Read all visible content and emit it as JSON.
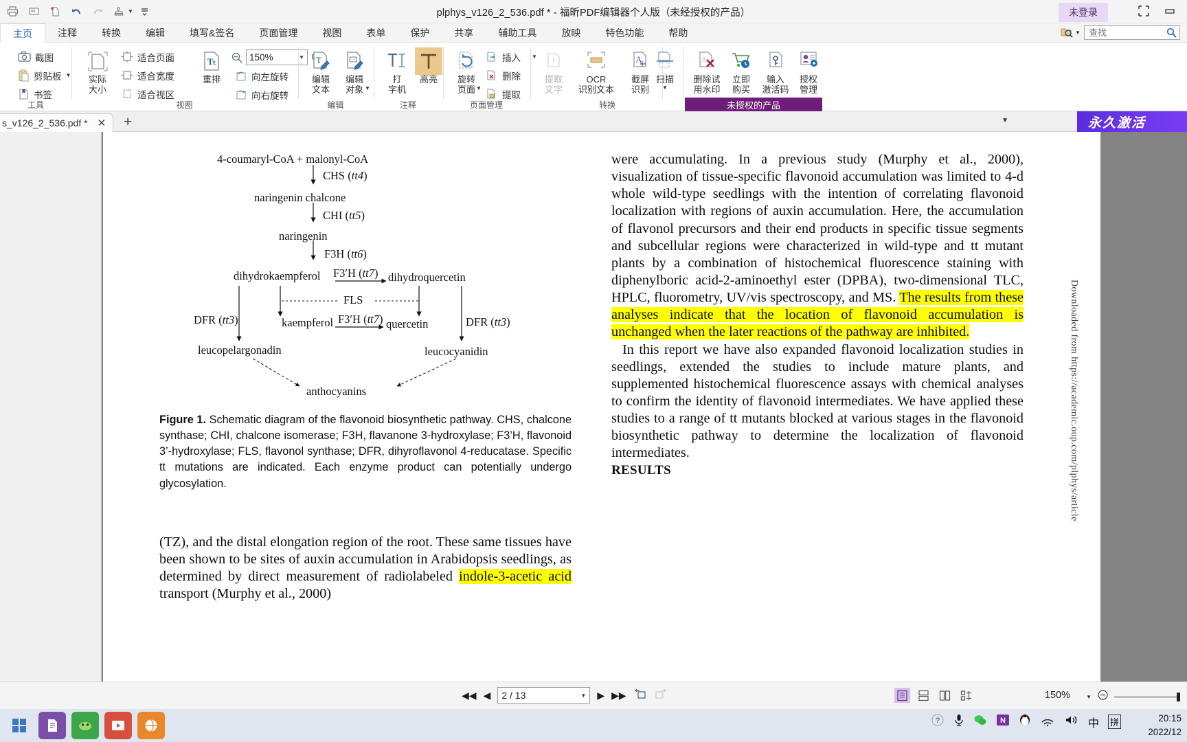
{
  "titlebar": {
    "title": "plphys_v126_2_536.pdf * - 福昕PDF编辑器个人版（未经授权的产品）",
    "login_badge": "未登录",
    "quick_access": [
      {
        "name": "print-icon",
        "label": "打印"
      },
      {
        "name": "email-icon",
        "label": "邮件"
      },
      {
        "name": "new-document-icon",
        "label": "新建"
      },
      {
        "name": "undo-icon",
        "label": "撤销"
      },
      {
        "name": "redo-icon",
        "label": "重做"
      },
      {
        "name": "stamp-icon",
        "label": "图章"
      }
    ],
    "window_controls": [
      "restore-grid",
      "minimize"
    ]
  },
  "menubar": {
    "items": [
      {
        "label": "主页",
        "active": true
      },
      {
        "label": "注释",
        "active": false
      },
      {
        "label": "转换",
        "active": false
      },
      {
        "label": "编辑",
        "active": false
      },
      {
        "label": "填写&签名",
        "active": false
      },
      {
        "label": "页面管理",
        "active": false
      },
      {
        "label": "视图",
        "active": false
      },
      {
        "label": "表单",
        "active": false
      },
      {
        "label": "保护",
        "active": false
      },
      {
        "label": "共享",
        "active": false
      },
      {
        "label": "辅助工具",
        "active": false
      },
      {
        "label": "放映",
        "active": false
      },
      {
        "label": "特色功能",
        "active": false
      },
      {
        "label": "帮助",
        "active": false
      }
    ],
    "search": {
      "placeholder": "查找",
      "value": ""
    }
  },
  "ribbon": {
    "groups": [
      {
        "name": "tools",
        "label": "工具",
        "commands": [
          {
            "label": "截图",
            "icon": "camera-icon"
          },
          {
            "label": "剪贴板",
            "icon": "clipboard-icon",
            "dropdown": true
          },
          {
            "label": "书签",
            "icon": "bookmark-icon"
          }
        ]
      },
      {
        "name": "view",
        "label": "视图",
        "commands": [
          {
            "label": "实际\n大小",
            "icon": "actual-size-icon"
          },
          {
            "label": "适合页面",
            "icon": "fit-page-icon"
          },
          {
            "label": "适合宽度",
            "icon": "fit-width-icon"
          },
          {
            "label": "适合视区",
            "icon": "fit-visible-icon"
          },
          {
            "label": "重排",
            "icon": "reflow-icon"
          },
          {
            "label": "向左旋转",
            "icon": "rotate-left-icon"
          },
          {
            "label": "向右旋转",
            "icon": "rotate-right-icon"
          }
        ],
        "zoom_value": "150%"
      },
      {
        "name": "edit",
        "label": "编辑",
        "commands": [
          {
            "label": "编辑\n文本",
            "icon": "edit-text-icon"
          },
          {
            "label": "编辑\n对象",
            "icon": "edit-object-icon",
            "dropdown": true
          }
        ]
      },
      {
        "name": "comment",
        "label": "注释",
        "commands": [
          {
            "label": "打\n字机",
            "icon": "typewriter-icon"
          },
          {
            "label": "高亮",
            "icon": "highlight-icon",
            "selected": true
          }
        ]
      },
      {
        "name": "page-manage",
        "label": "页面管理",
        "commands": [
          {
            "label": "旋转\n页面",
            "icon": "rotate-page-icon",
            "dropdown": true
          },
          {
            "label": "插入",
            "icon": "insert-page-icon",
            "dropdown": true
          },
          {
            "label": "删除",
            "icon": "delete-page-icon"
          },
          {
            "label": "提取",
            "icon": "extract-page-icon"
          }
        ]
      },
      {
        "name": "convert",
        "label": "转换",
        "commands": [
          {
            "label": "提取\n文字",
            "icon": "extract-text-icon",
            "disabled": true
          },
          {
            "label": "OCR\n识别文本",
            "icon": "ocr-icon"
          },
          {
            "label": "截屏\n识别",
            "icon": "screen-ocr-icon"
          },
          {
            "label": "扫描",
            "icon": "scan-icon",
            "dropdown": true
          }
        ]
      },
      {
        "name": "license",
        "label": "未授权的产品",
        "commands": [
          {
            "label": "删除试\n用水印",
            "icon": "remove-watermark-icon"
          },
          {
            "label": "立即\n购买",
            "icon": "buy-now-icon"
          },
          {
            "label": "输入\n激活码",
            "icon": "activation-key-icon"
          },
          {
            "label": "授权\n管理",
            "icon": "license-manage-icon"
          }
        ]
      }
    ]
  },
  "tabbar": {
    "tab_label": "s_v126_2_536.pdf *",
    "close_glyph": "✕",
    "new_tab_glyph": "+",
    "activate_label": "永久激活"
  },
  "document": {
    "figure": {
      "nodes": [
        {
          "id": "substrate",
          "text": "4-coumaryl-CoA + malonyl-CoA"
        },
        {
          "id": "naringenin-chalcone",
          "text": "naringenin chalcone"
        },
        {
          "id": "naringenin",
          "text": "naringenin"
        },
        {
          "id": "dihydrokaempferol",
          "text": "dihydrokaempferol"
        },
        {
          "id": "dihydroquercetin",
          "text": "dihydroquercetin"
        },
        {
          "id": "kaempferol",
          "text": "kaempferol"
        },
        {
          "id": "quercetin",
          "text": "quercetin"
        },
        {
          "id": "leucopelargonadin",
          "text": "leucopelargonadin"
        },
        {
          "id": "leucocyanidin",
          "text": "leucocyanidin"
        },
        {
          "id": "anthocyanins",
          "text": "anthocyanins"
        }
      ],
      "enzymes": [
        {
          "name": "CHS",
          "gene": "tt4"
        },
        {
          "name": "CHI",
          "gene": "tt5"
        },
        {
          "name": "F3H",
          "gene": "tt6"
        },
        {
          "name": "F3′H",
          "gene": "tt7"
        },
        {
          "name": "FLS",
          "gene": ""
        },
        {
          "name": "F3′H",
          "gene": "tt7"
        },
        {
          "name": "DFR",
          "gene": "tt3"
        },
        {
          "name": "DFR",
          "gene": "tt3"
        }
      ],
      "caption_label": "Figure 1.",
      "caption": " Schematic diagram of the flavonoid biosynthetic pathway. CHS, chalcone synthase; CHI, chalcone isomerase; F3H, flavanone 3-hydroxylase; F3’H, flavonoid 3’-hydroxylase; FLS, flavonol synthase; DFR, dihyroflavonol 4-reducatase. Specific tt mutations are indicated. Each enzyme product can potentially undergo glycosylation."
    },
    "left_column": {
      "para1_a": "(TZ), and the distal elongation region of the root. These same tissues have been shown to be sites of auxin accumulation in Arabidopsis seedlings, as determined by direct measurement of radiolabeled ",
      "para1_hl": "indole-3-acetic acid",
      "para1_b": " transport (Murphy et al., 2000)"
    },
    "right_column": {
      "para1": "were accumulating. In a previous study (Murphy et al., 2000), visualization of tissue-specific flavonoid accumulation was limited to 4-d whole wild-type seedlings with the intention of correlating flavonoid localization with regions of auxin accumulation. Here, the accumulation of flavonol precursors and their end products in specific tissue segments and subcellular regions were characterized in wild-type and tt mutant plants by a combination of histochemical fluorescence staining with diphenylboric acid-2-aminoethyl ester (DPBA), two-dimensional TLC, HPLC, fluorometry, UV/vis spectroscopy, and MS. ",
      "para1_hl": "The results from these analyses indicate that the location of flavonoid accumulation is unchanged when the later reactions of the pathway are inhibited.",
      "para2": "In this report we have also expanded flavonoid localization studies in seedlings, extended the studies to include mature plants, and supplemented histochemical fluorescence assays with chemical analyses to confirm the identity of flavonoid intermediates. We have applied these studies to a range of tt mutants blocked at various stages in the flavonoid biosynthetic pathway to determine the localization of flavonoid intermediates.",
      "section_heading": "RESULTS"
    },
    "side_watermark": "Downloaded from https://academic.oup.com/plphys/article"
  },
  "statusbar": {
    "page_value": "2 / 13",
    "zoom_value": "150%",
    "nav": [
      {
        "name": "first-page-button",
        "glyph": "◀◀"
      },
      {
        "name": "previous-page-button",
        "glyph": "◀"
      },
      {
        "name": "next-page-button",
        "glyph": "▶"
      },
      {
        "name": "last-page-button",
        "glyph": "▶▶"
      }
    ],
    "view_modes": [
      "single-page-mode",
      "continuous-mode",
      "facing-mode",
      "facing-continuous-mode"
    ]
  },
  "taskbar": {
    "time": "20:15",
    "date": "2022/12",
    "ime_lang": "中",
    "ime_mode": "拼",
    "apps": [
      {
        "name": "start-button",
        "glyph": "⊞"
      },
      {
        "name": "taskbar-foxit",
        "glyph": "📄"
      },
      {
        "name": "taskbar-game",
        "glyph": "🎮"
      },
      {
        "name": "taskbar-media",
        "glyph": "🎬"
      },
      {
        "name": "taskbar-browser",
        "glyph": "🌐"
      }
    ],
    "tray": [
      {
        "name": "tray-help-icon",
        "glyph": "?"
      },
      {
        "name": "tray-mic-icon",
        "glyph": "🎤"
      },
      {
        "name": "tray-wechat-icon",
        "glyph": "●"
      },
      {
        "name": "tray-onenote-icon",
        "glyph": "N"
      },
      {
        "name": "tray-qq-icon",
        "glyph": "●"
      },
      {
        "name": "tray-wifi-icon",
        "glyph": "◞"
      },
      {
        "name": "tray-volume-icon",
        "glyph": "🔊"
      }
    ]
  }
}
